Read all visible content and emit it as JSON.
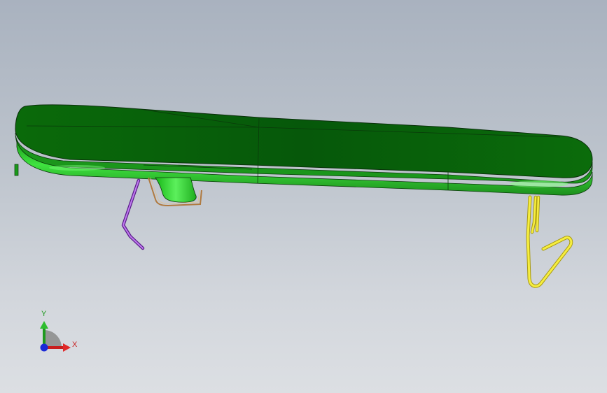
{
  "viewport": {
    "background_top": "#a9b2bf",
    "background_bottom": "#dcdfe3"
  },
  "model": {
    "parts": [
      {
        "name": "main-panel",
        "color": "#0e7a0e",
        "highlight": "#3fe23f"
      },
      {
        "name": "center-bracket",
        "color": "#2fd62f"
      },
      {
        "name": "left-rod",
        "color": "#9b3fd0"
      },
      {
        "name": "small-wire",
        "color": "#b07a40"
      },
      {
        "name": "right-clip",
        "color": "#f2ea3a"
      }
    ]
  },
  "triad": {
    "y_label": "Y",
    "x_label": "X",
    "y_color": "#1e9a1e",
    "x_color": "#c81e1e",
    "z_color": "#1a2ad6"
  }
}
